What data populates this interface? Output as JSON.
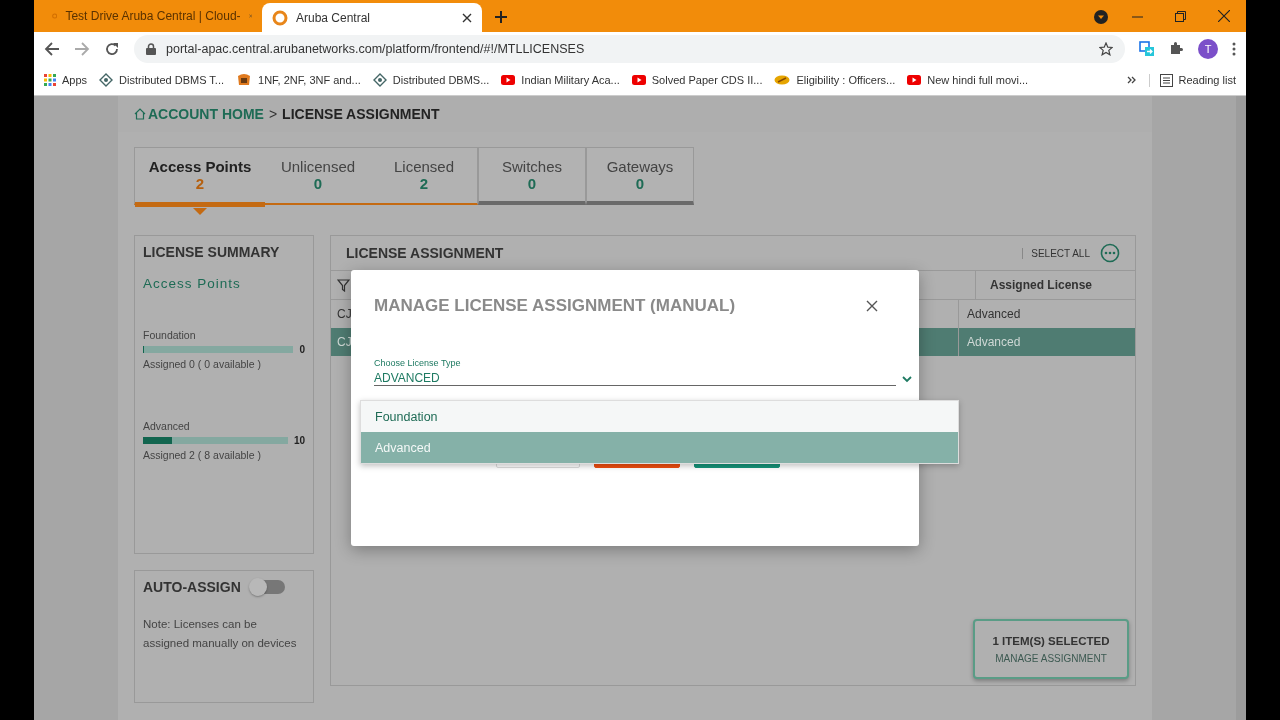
{
  "browser": {
    "tabs": [
      {
        "title": "Test Drive Aruba Central | Cloud-",
        "selected": false
      },
      {
        "title": "Aruba Central",
        "selected": true
      }
    ],
    "url": "portal-apac.central.arubanetworks.com/platform/frontend/#!/MTLLICENSES",
    "profile": "T",
    "bookmarks": [
      {
        "label": "Apps",
        "kind": "apps"
      },
      {
        "label": "Distributed DBMS T...",
        "kind": "diamond"
      },
      {
        "label": "1NF, 2NF, 3NF and...",
        "kind": "badge"
      },
      {
        "label": "Distributed DBMS...",
        "kind": "diamond"
      },
      {
        "label": "Indian Military Aca...",
        "kind": "video"
      },
      {
        "label": "Solved Paper CDS II...",
        "kind": "video"
      },
      {
        "label": "Eligibility : Officers...",
        "kind": "oval"
      },
      {
        "label": "New hindi full movi...",
        "kind": "video"
      }
    ],
    "reading_list": "Reading list"
  },
  "breadcrumb": {
    "home": "ACCOUNT HOME",
    "separator": ">",
    "current": "LICENSE ASSIGNMENT"
  },
  "tab_groups": [
    {
      "tabs": [
        {
          "label": "Access Points",
          "count": "2",
          "selected": true
        },
        {
          "label": "Unlicensed",
          "count": "0",
          "selected": false
        },
        {
          "label": "Licensed",
          "count": "2",
          "selected": false
        }
      ]
    },
    {
      "tabs": [
        {
          "label": "Switches",
          "count": "0",
          "selected": false
        }
      ]
    },
    {
      "tabs": [
        {
          "label": "Gateways",
          "count": "0",
          "selected": false
        }
      ]
    }
  ],
  "summary": {
    "title": "LICENSE SUMMARY",
    "subtitle": "Access Points",
    "licenses": [
      {
        "name": "Foundation",
        "total": "0",
        "level": 0,
        "assigned": "Assigned 0 ( 0 available )"
      },
      {
        "name": "Advanced",
        "total": "10",
        "level": 0.2,
        "assigned": "Assigned 2 ( 8 available )"
      }
    ]
  },
  "auto_assign": {
    "title": "AUTO-ASSIGN",
    "on": false,
    "note": "Note: Licenses can be assigned manually on devices"
  },
  "assignment": {
    "title": "LICENSE ASSIGNMENT",
    "select_all": "SELECT ALL",
    "license_column": "Assigned License",
    "rows": [
      {
        "column_1": "CJ",
        "license": "Advanced",
        "selected": false
      },
      {
        "column_1": "CJ",
        "license": "Advanced",
        "selected": true
      }
    ]
  },
  "selection": {
    "count": "1 ITEM(S) SELECTED",
    "action": "MANAGE ASSIGNMENT"
  },
  "modal": {
    "title": "MANAGE LICENSE ASSIGNMENT (MANUAL)",
    "field_label": "Choose License Type",
    "value": "ADVANCED",
    "options": [
      {
        "label": "Foundation",
        "selected": false
      },
      {
        "label": "Advanced",
        "selected": true
      }
    ]
  }
}
